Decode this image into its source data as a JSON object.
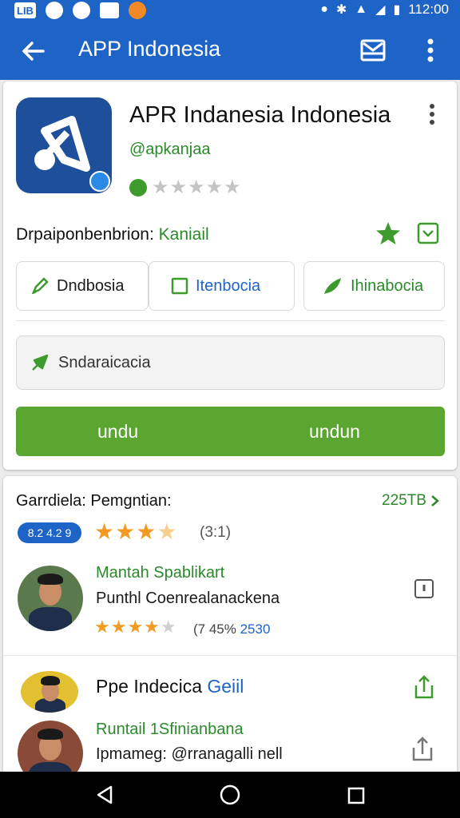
{
  "status_bar": {
    "left_box_1": "LIB",
    "time": "112:00"
  },
  "app_bar": {
    "title": "APP Indonesia"
  },
  "app_info": {
    "name": "APR Indanesia Indonesia",
    "handle": "@apkanjaa",
    "developer_label": "Drpaiponbenbrion:",
    "developer_value": "Kaniail"
  },
  "actions": {
    "chip_1": "Dndbosia",
    "chip_2": "Itenbocia",
    "chip_3": "Ihinabocia",
    "field_text": "Sndaraicacia",
    "download_left": "undu",
    "download_right": "undun"
  },
  "reviews": {
    "heading": "Garrdiela: Pemgntian:",
    "count": "225TB",
    "pill": "8.2 4.2 9",
    "rating": "(3:1)",
    "items": [
      {
        "name": "Mantah Spablikart",
        "text": "Punthl Coenrealanackena",
        "meta_prefix": "(7 45% ",
        "meta_value": "2530"
      },
      {
        "title": "Ppe Indecica",
        "title_suffix": "Geiil"
      },
      {
        "name": "Runtail 1Sfinianbana",
        "text": "Ipmameg: @rranagalli nell"
      }
    ]
  },
  "colors": {
    "primary": "#1e63c6",
    "accent_green": "#5aa631",
    "star_orange": "#f29a22"
  }
}
